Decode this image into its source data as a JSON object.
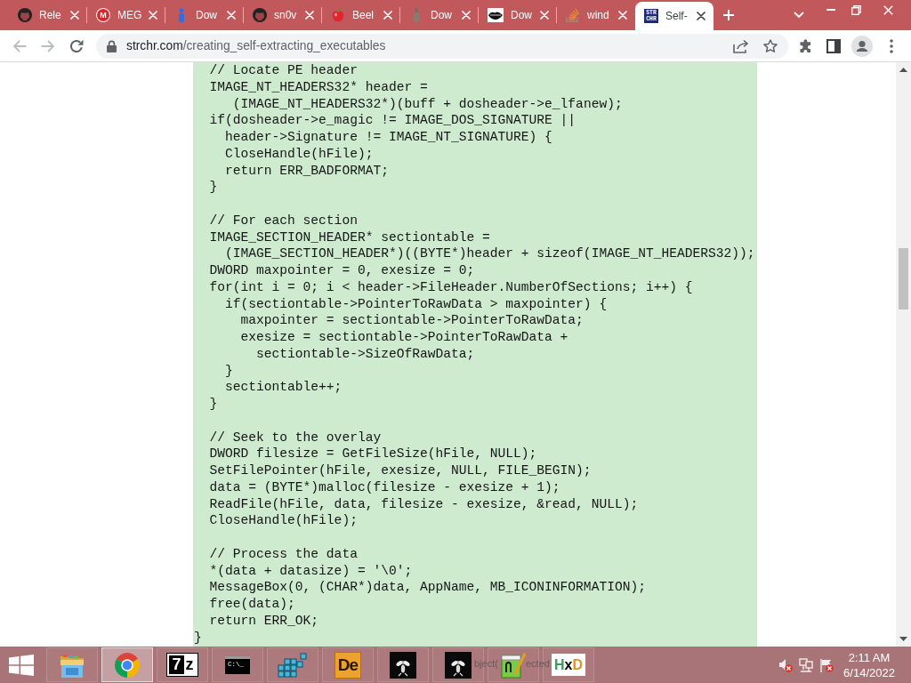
{
  "browser": {
    "tabs": [
      {
        "kind": "cat",
        "title": "Rele",
        "selected": false
      },
      {
        "kind": "letter",
        "icon_text": [
          "M"
        ],
        "title": "MEG",
        "selected": false
      },
      {
        "kind": "figure",
        "title": "Dow",
        "selected": false
      },
      {
        "kind": "cat",
        "title": "sn0v",
        "selected": false
      },
      {
        "kind": "apple",
        "title": "Beel",
        "selected": false
      },
      {
        "kind": "bottle",
        "title": "Dow",
        "selected": false
      },
      {
        "kind": "lips",
        "title": "Dow",
        "selected": false
      },
      {
        "kind": "stack",
        "title": "wind",
        "selected": false
      },
      {
        "kind": "badge",
        "icon_text": [
          "STR",
          "CHR"
        ],
        "title": "Self-",
        "selected": true
      }
    ],
    "toolbar": {
      "back": {
        "disabled": true
      },
      "forward": {
        "disabled": true
      },
      "url": {
        "host": "strchr.com",
        "path": "/creating_self-extracting_executables"
      }
    }
  },
  "page": {
    "code_blocks": [
      [
        "  // Locate PE header",
        "  IMAGE_NT_HEADERS32* header =",
        "     (IMAGE_NT_HEADERS32*)(buff + dosheader->e_lfanew);",
        "  if(dosheader->e_magic != IMAGE_DOS_SIGNATURE ||",
        "    header->Signature != IMAGE_NT_SIGNATURE) {",
        "    CloseHandle(hFile);",
        "    return ERR_BADFORMAT;",
        "  }"
      ],
      [
        "  // For each section",
        "  IMAGE_SECTION_HEADER* sectiontable =",
        "    (IMAGE_SECTION_HEADER*)((BYTE*)header + sizeof(IMAGE_NT_HEADERS32));",
        "  DWORD maxpointer = 0, exesize = 0;",
        "  for(int i = 0; i < header->FileHeader.NumberOfSections; i++) {",
        "    if(sectiontable->PointerToRawData > maxpointer) {",
        "      maxpointer = sectiontable->PointerToRawData;",
        "      exesize = sectiontable->PointerToRawData +",
        "        sectiontable->SizeOfRawData;",
        "    }",
        "    sectiontable++;",
        "  }"
      ],
      [
        "  // Seek to the overlay",
        "  DWORD filesize = GetFileSize(hFile, NULL);",
        "  SetFilePointer(hFile, exesize, NULL, FILE_BEGIN);",
        "  data = (BYTE*)malloc(filesize - exesize + 1);",
        "  ReadFile(hFile, data, filesize - exesize, &read, NULL);",
        "  CloseHandle(hFile);"
      ],
      [
        "  // Process the data",
        "  *(data + datasize) = '\\0';",
        "  MessageBox(0, (CHAR*)data, AppName, MB_ICONINFORMATION);",
        "  free(data);",
        "  return ERR_OK;",
        "}"
      ]
    ]
  },
  "taskbar": {
    "apps": [
      {
        "kind": "folder",
        "selected": false
      },
      {
        "kind": "browser",
        "selected": true
      },
      {
        "kind": "split-logo",
        "icon_text": "7z",
        "selected": false
      },
      {
        "kind": "terminal",
        "icon_text": "C:\\_",
        "selected": false
      },
      {
        "kind": "cubes",
        "selected": false
      },
      {
        "kind": "tile-logo",
        "icon_text": "De",
        "selected": false
      },
      {
        "kind": "insect",
        "selected": false
      },
      {
        "kind": "insect",
        "selected": false
      },
      {
        "kind": "notepad",
        "selected": false
      },
      {
        "kind": "tricolor-logo",
        "icon_text": "HxD",
        "selected": false
      }
    ],
    "faded_text": [
      "bject(",
      "ected"
    ],
    "tray": [
      {
        "kind": "speaker",
        "alert": true
      },
      {
        "kind": "network",
        "alert": false
      },
      {
        "kind": "flag",
        "alert": true
      }
    ],
    "clock": {
      "time": "2:11 AM",
      "date": "6/14/2022"
    }
  }
}
